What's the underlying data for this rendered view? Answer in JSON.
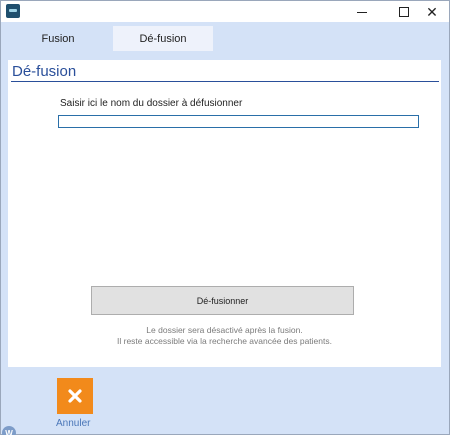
{
  "window": {
    "controls": {
      "minimize": "",
      "maximize": "",
      "close": "✕"
    }
  },
  "tabs": [
    {
      "label": "Fusion",
      "active": false
    },
    {
      "label": "Dé-fusion",
      "active": true
    }
  ],
  "panel": {
    "title": "Dé-fusion",
    "field_label": "Saisir ici le nom du dossier à défusionner",
    "field_value": "",
    "button_label": "Dé-fusionner",
    "info_line1": "Le dossier sera désactivé après la fusion.",
    "info_line2": "Il reste accessible via la recherche avancée des patients."
  },
  "footer": {
    "cancel_label": "Annuler",
    "cancel_icon": "close-icon",
    "badge_text": "W"
  },
  "colors": {
    "window_bg": "#d4e2f7",
    "accent": "#2a4f9a",
    "cancel_orange": "#f28a1b",
    "cancel_text": "#4a76b8"
  }
}
